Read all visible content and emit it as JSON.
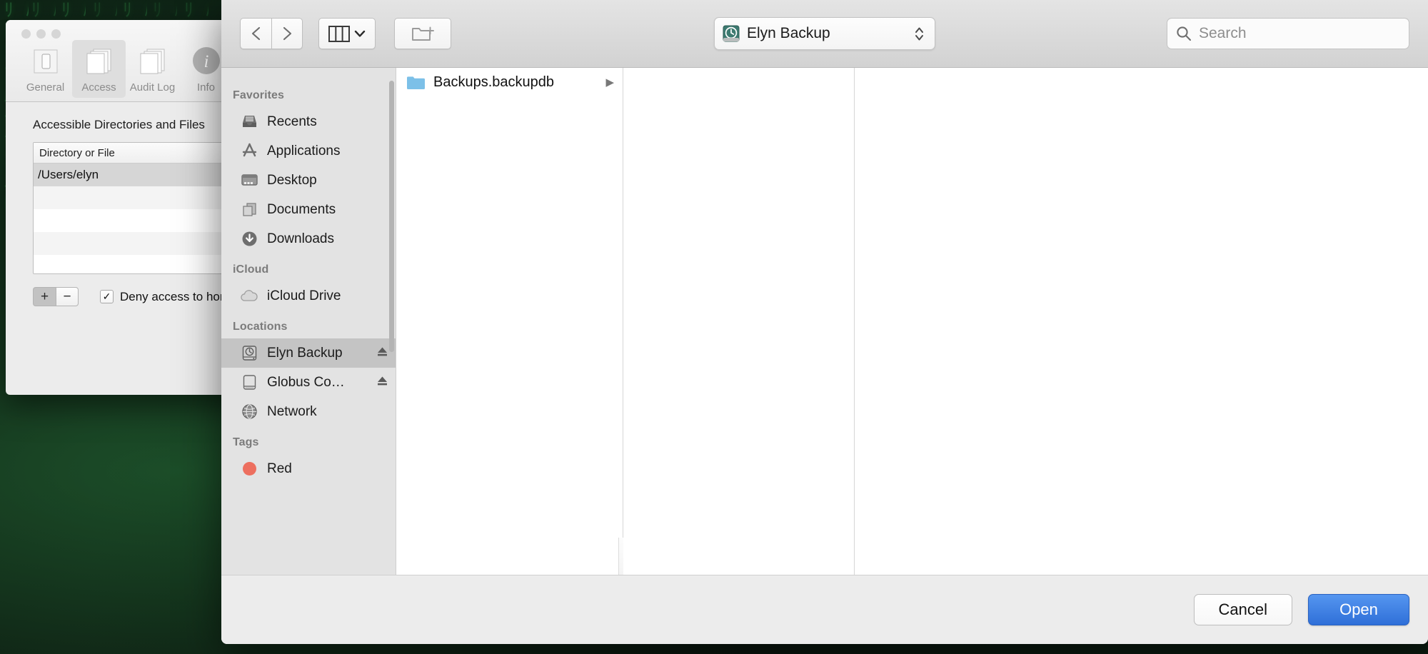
{
  "desktop": {
    "glyph_rows": "ﾘ ﾊ ｳ\nﾄ ｵ ｼ\nﾝ ﾍ ﾏ\nｱ ﾖ ﾂ\nﾑ ﾈ ｹ\nﾁ ｿ ﾗ\nﾃ ﾇ ｸ\nﾌ ﾅ ﾆ\nﾕ ｺ ｷ\nﾛ ﾒ ｴ"
  },
  "prefs_window": {
    "tabs": [
      {
        "label": "General",
        "icon": "switch-icon",
        "active": false
      },
      {
        "label": "Access",
        "icon": "documents-icon",
        "active": true
      },
      {
        "label": "Audit Log",
        "icon": "documents-icon",
        "active": false
      },
      {
        "label": "Info",
        "icon": "info-icon",
        "active": false
      }
    ],
    "heading": "Accessible Directories and Files",
    "table": {
      "column_header": "Directory or File",
      "rows": [
        "/Users/elyn",
        "",
        "",
        "",
        ""
      ]
    },
    "add_button": "+",
    "remove_button": "−",
    "deny_checkbox": {
      "checked": true,
      "check_glyph": "✓",
      "label": "Deny access to home directory"
    }
  },
  "dialog": {
    "toolbar": {
      "back_label": "‹",
      "forward_label": "›",
      "view_mode": "column-view-icon",
      "view_chevron": "⌄",
      "new_folder": "new-folder-icon",
      "location": {
        "title": "Elyn Backup",
        "icon": "time-machine-disk-icon"
      },
      "search": {
        "placeholder": "Search",
        "icon": "search-icon"
      }
    },
    "sidebar": {
      "sections": [
        {
          "title": "Favorites",
          "items": [
            {
              "label": "Recents",
              "icon": "recents-tray-icon",
              "selected": false,
              "eject": false
            },
            {
              "label": "Applications",
              "icon": "applications-icon",
              "selected": false,
              "eject": false
            },
            {
              "label": "Desktop",
              "icon": "desktop-monitor-icon",
              "selected": false,
              "eject": false
            },
            {
              "label": "Documents",
              "icon": "documents-pages-icon",
              "selected": false,
              "eject": false
            },
            {
              "label": "Downloads",
              "icon": "downloads-arrow-icon",
              "selected": false,
              "eject": false
            }
          ]
        },
        {
          "title": "iCloud",
          "items": [
            {
              "label": "iCloud Drive",
              "icon": "cloud-icon",
              "selected": false,
              "eject": false
            }
          ]
        },
        {
          "title": "Locations",
          "items": [
            {
              "label": "Elyn Backup",
              "icon": "time-machine-disk-icon",
              "selected": true,
              "eject": true
            },
            {
              "label": "Globus Co…",
              "icon": "hard-disk-icon",
              "selected": false,
              "eject": true
            },
            {
              "label": "Network",
              "icon": "network-globe-icon",
              "selected": false,
              "eject": false
            }
          ]
        },
        {
          "title": "Tags",
          "items": [
            {
              "label": "Red",
              "icon": "red-tag-dot",
              "selected": false,
              "eject": false,
              "color": "#ed6f5f"
            }
          ]
        }
      ]
    },
    "columns": [
      {
        "items": [
          {
            "name": "Backups.backupdb",
            "icon": "blue-folder-icon",
            "has_children": true,
            "arrow": "▶"
          }
        ]
      },
      {
        "items": []
      },
      {
        "items": []
      }
    ],
    "footer": {
      "cancel_label": "Cancel",
      "open_label": "Open"
    }
  },
  "colors": {
    "accent": "#2f6fd8",
    "selection": "#c4c4c4",
    "tag_red": "#ed6f5f",
    "folder_blue": "#7cc0e8"
  }
}
